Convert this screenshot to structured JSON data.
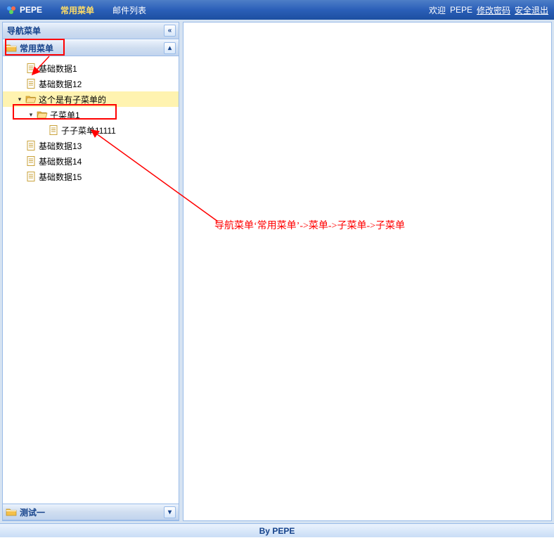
{
  "header": {
    "app_name": "PEPE",
    "tabs": [
      {
        "label": "常用菜单",
        "active": true
      },
      {
        "label": "邮件列表",
        "active": false
      }
    ],
    "welcome_prefix": "欢迎",
    "welcome_user": "PEPE",
    "link_change_pwd": "修改密码",
    "link_logout": "安全退出"
  },
  "sidebar": {
    "title": "导航菜单",
    "collapse_glyph": "«",
    "panels": [
      {
        "title": "常用菜单",
        "expanded": true,
        "toggle_glyph": "▴",
        "tree": [
          {
            "level": 1,
            "expander": "",
            "icon": "doc",
            "label": "基础数据1",
            "selected": false
          },
          {
            "level": 1,
            "expander": "",
            "icon": "doc",
            "label": "基础数据12",
            "selected": false
          },
          {
            "level": 1,
            "expander": "▾",
            "icon": "folder-open",
            "label": "这个是有子菜单的",
            "selected": true
          },
          {
            "level": 2,
            "expander": "▾",
            "icon": "folder-open",
            "label": "子菜单1",
            "selected": false
          },
          {
            "level": 3,
            "expander": "",
            "icon": "doc",
            "label": "子子菜单11111",
            "selected": false
          },
          {
            "level": 1,
            "expander": "",
            "icon": "doc",
            "label": "基础数据13",
            "selected": false
          },
          {
            "level": 1,
            "expander": "",
            "icon": "doc",
            "label": "基础数据14",
            "selected": false
          },
          {
            "level": 1,
            "expander": "",
            "icon": "doc",
            "label": "基础数据15",
            "selected": false
          }
        ]
      },
      {
        "title": "测试一",
        "expanded": false,
        "toggle_glyph": "▾"
      }
    ]
  },
  "annotation": {
    "text": "导航菜单‘常用菜单’->菜单->子菜单->子菜单"
  },
  "footer": {
    "text": "By PEPE"
  }
}
